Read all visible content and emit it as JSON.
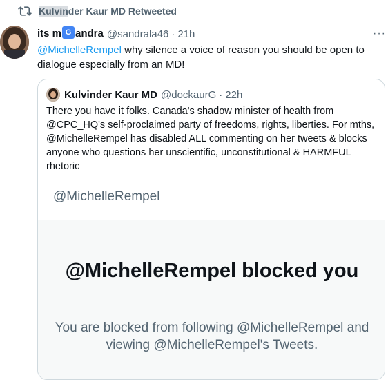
{
  "retweet": {
    "name_highlighted": "Kulvin",
    "name_rest": "der Kaur MD",
    "suffix": " Retweeted"
  },
  "tweet": {
    "name_start": "its m",
    "translate_glyph": "G",
    "name_end": "andra",
    "handle": "@sandrala46",
    "separator": "·",
    "time": "21h",
    "more_label": "···",
    "mention": "@MichelleRempel",
    "text": " why silence a voice of reason you should be open to dialogue especially from an MD!"
  },
  "quote": {
    "name": "Kulvinder Kaur MD",
    "handle": "@dockaurG",
    "separator": "·",
    "time": "22h",
    "text": "There you have it folks. Canada's shadow minister of health from @CPC_HQ's self-proclaimed party of freedoms, rights, liberties. For mths, @MichelleRempel has disabled ALL commenting on her tweets & blocks anyone who questions her unscientific, unconstitutional & HARMFUL rhetoric",
    "image": {
      "handle": "@MichelleRempel",
      "title": "@MichelleRempel blocked you",
      "body": "You are blocked from following @MichelleRempel and viewing @MichelleRempel's Tweets."
    }
  },
  "colors": {
    "link": "#1d9bf0",
    "secondary_text": "#536471",
    "border": "#cfd9de"
  },
  "icons": [
    "retweet-icon",
    "translate-icon",
    "more-icon"
  ]
}
